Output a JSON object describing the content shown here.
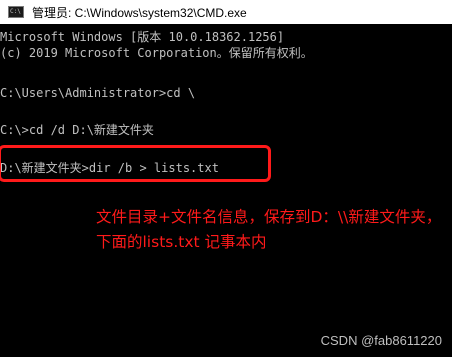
{
  "window": {
    "title": "管理员: C:\\Windows\\system32\\CMD.exe",
    "icon": "cmd-icon",
    "icon_text": "C:\\",
    "background": "#000000",
    "text_color": "#c0c0c0"
  },
  "console": {
    "lines": [
      "Microsoft Windows [版本 10.0.18362.1256]",
      "(c) 2019 Microsoft Corporation。保留所有权利。",
      "C:\\Users\\Administrator>cd \\",
      "C:\\>cd /d D:\\新建文件夹",
      "D:\\新建文件夹>dir /b > lists.txt"
    ]
  },
  "annotation": {
    "text": "文件目录+文件名信息，保存到D：\\\\新建文件夹，下面的lists.txt 记事本内",
    "color": "#ff1a1a"
  },
  "watermark": {
    "text": "CSDN @fab8611220"
  }
}
